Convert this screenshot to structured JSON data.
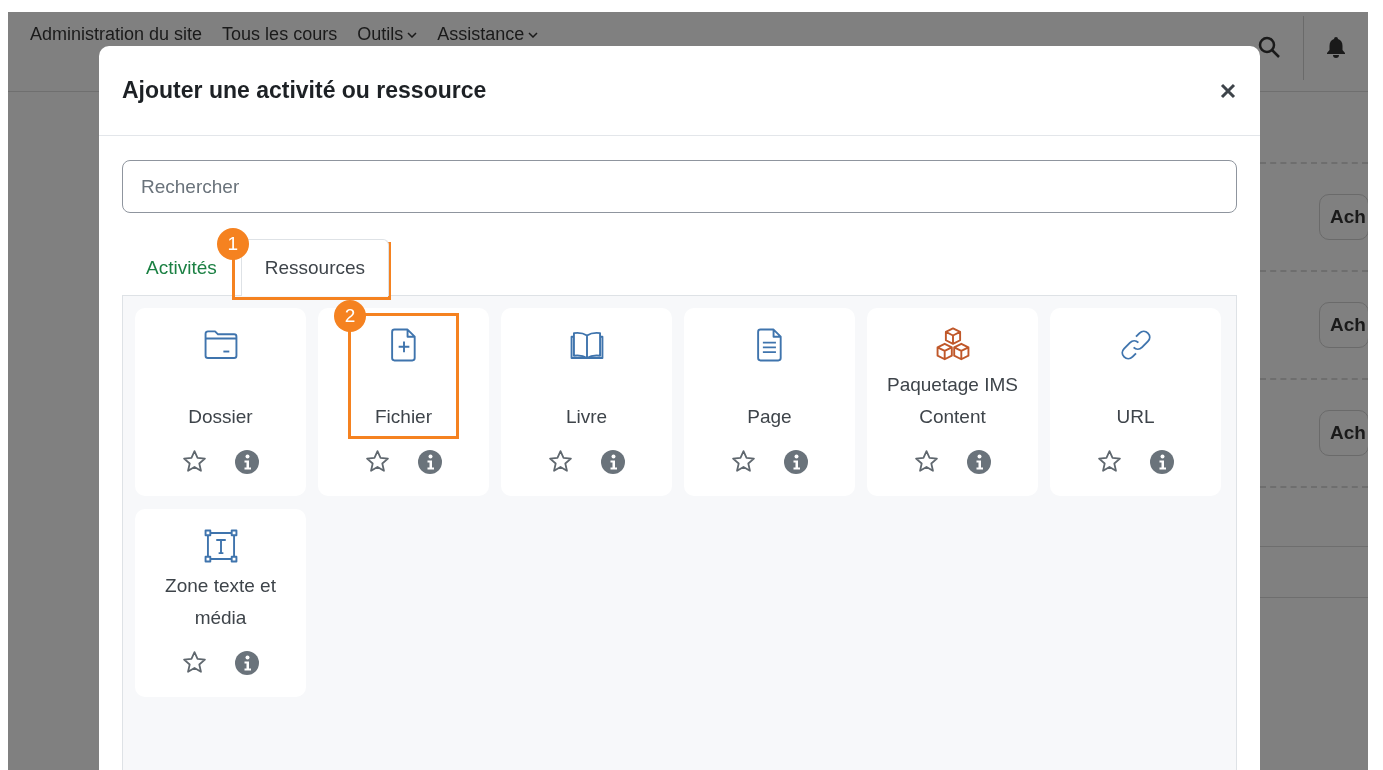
{
  "background": {
    "nav": [
      {
        "label": "Administration du site",
        "has_menu": false
      },
      {
        "label": "Tous les cours",
        "has_menu": false
      },
      {
        "label": "Outils",
        "has_menu": true
      },
      {
        "label": "Assistance",
        "has_menu": true
      }
    ],
    "buttons": [
      "Ach",
      "Ach",
      "Ach"
    ]
  },
  "dialog": {
    "title": "Ajouter une activité ou ressource",
    "search": {
      "placeholder": "Rechercher"
    },
    "tabs": [
      {
        "label": "Activités",
        "selected": false
      },
      {
        "label": "Ressources",
        "selected": true,
        "callout": "1"
      }
    ],
    "items": [
      {
        "name": "Dossier",
        "kind": "folder",
        "starred": false
      },
      {
        "name": "Fichier",
        "kind": "file",
        "starred": false,
        "callout": "2"
      },
      {
        "name": "Livre",
        "kind": "book",
        "starred": false
      },
      {
        "name": "Page",
        "kind": "page",
        "starred": false
      },
      {
        "name": "Paquetage IMS Content",
        "kind": "package",
        "starred": false
      },
      {
        "name": "URL",
        "kind": "link",
        "starred": false
      },
      {
        "name": "Zone texte et média",
        "kind": "textarea",
        "starred": false
      }
    ]
  }
}
